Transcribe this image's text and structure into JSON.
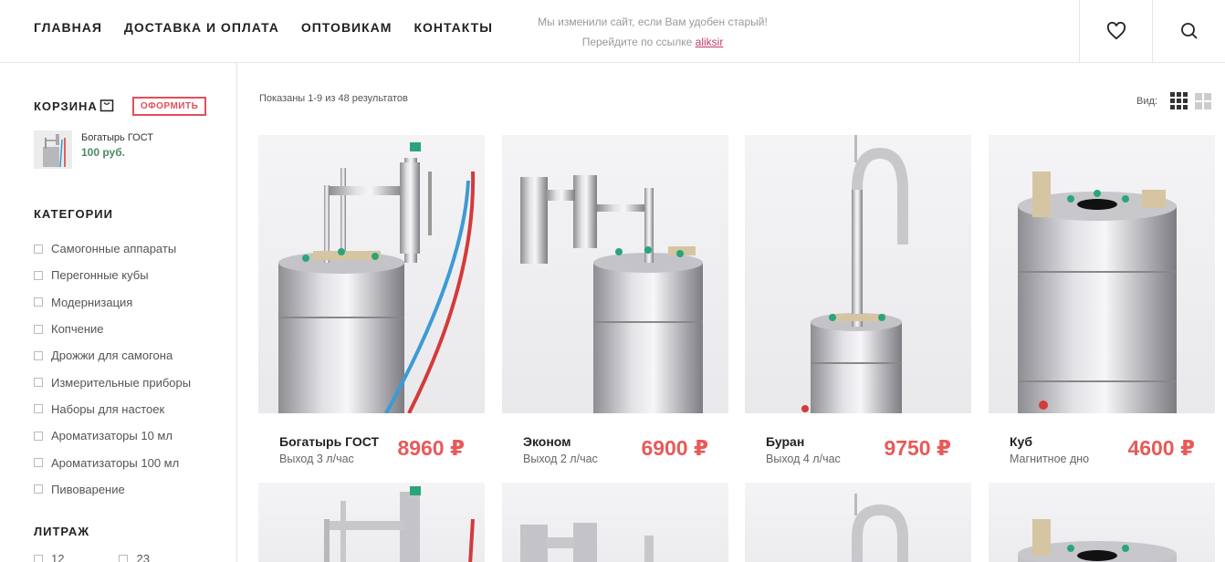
{
  "nav": [
    "ГЛАВНАЯ",
    "ДОСТАВКА И ОПЛАТА",
    "ОПТОВИКАМ",
    "КОНТАКТЫ"
  ],
  "notice": {
    "line1": "Мы изменили сайт, если Вам удобен старый!",
    "line2_prefix": "Перейдите по ссылке ",
    "link": "aliksir"
  },
  "header_icons": [
    "heart-icon",
    "search-icon"
  ],
  "cart": {
    "title": "КОРЗИНА",
    "checkout": "ОФОРМИТЬ",
    "item_name": "Богатырь ГОСТ",
    "item_price": "100 руб."
  },
  "categories": {
    "title": "КАТЕГОРИИ",
    "items": [
      "Самогонные аппараты",
      "Перегонные кубы",
      "Модернизация",
      "Копчение",
      "Дрожжи для самогона",
      "Измерительные приборы",
      "Наборы для настоек",
      "Ароматизаторы 10 мл",
      "Ароматизаторы 100 мл",
      "Пивоварение"
    ]
  },
  "volume": {
    "title": "ЛИТРАЖ",
    "items": [
      "12",
      "23"
    ]
  },
  "results_text": "Показаны 1-9 из 48 результатов",
  "view_label": "Вид:",
  "products": [
    {
      "name": "Богатырь ГОСТ",
      "sub": "Выход 3 л/час",
      "price": "8960 ₽"
    },
    {
      "name": "Эконом",
      "sub": "Выход 2 л/час",
      "price": "6900 ₽"
    },
    {
      "name": "Буран",
      "sub": "Выход 4 л/час",
      "price": "9750 ₽"
    },
    {
      "name": "Куб",
      "sub": "Магнитное дно",
      "price": "4600 ₽"
    }
  ],
  "colors": {
    "accent": "#e85a5a",
    "cart_price": "#4b8a62",
    "link": "#c0396b"
  }
}
